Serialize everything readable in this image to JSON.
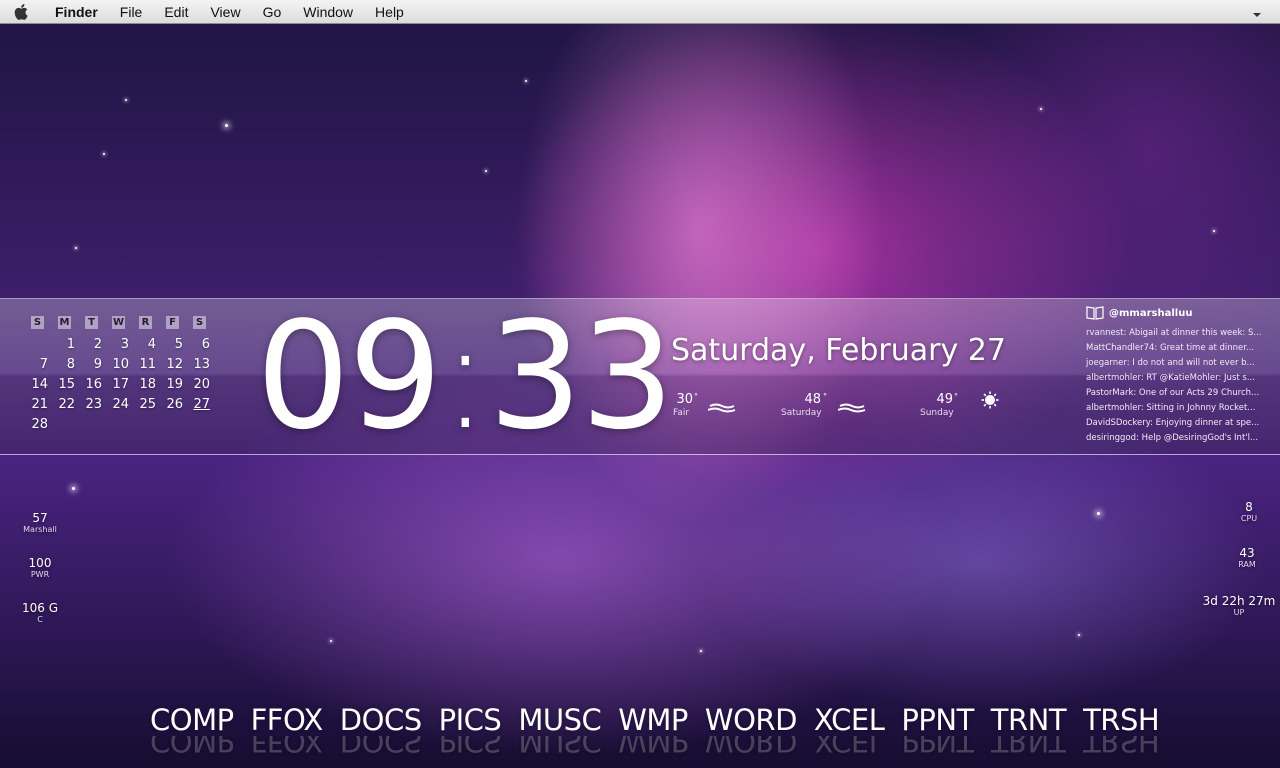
{
  "menubar": {
    "app": "Finder",
    "items": [
      "File",
      "Edit",
      "View",
      "Go",
      "Window",
      "Help"
    ]
  },
  "calendar": {
    "weekdays": [
      "S",
      "M",
      "T",
      "W",
      "R",
      "F",
      "S"
    ],
    "rows": [
      [
        "",
        "1",
        "2",
        "3",
        "4",
        "5",
        "6"
      ],
      [
        "7",
        "8",
        "9",
        "10",
        "11",
        "12",
        "13"
      ],
      [
        "14",
        "15",
        "16",
        "17",
        "18",
        "19",
        "20"
      ],
      [
        "21",
        "22",
        "23",
        "24",
        "25",
        "26",
        "27"
      ],
      [
        "28",
        "",
        "",
        "",
        "",
        "",
        ""
      ]
    ],
    "today": "27"
  },
  "clock": {
    "hours": "09",
    "minutes": "33"
  },
  "date": "Saturday, February 27",
  "weather": [
    {
      "temp": "30",
      "label": "Fair",
      "icon": "cloud-icon"
    },
    {
      "temp": "48",
      "label": "Saturday",
      "icon": "cloud-icon"
    },
    {
      "temp": "49",
      "label": "Sunday",
      "icon": "sun-icon"
    }
  ],
  "twitter": {
    "handle": "@mmarshalluu",
    "tweets": [
      "rvannest: Abigail at dinner this week: S...",
      "MattChandler74: Great time at dinner...",
      "joegarner: I do not and will not ever b...",
      "albertmohler: RT @KatieMohler: Just s...",
      "PastorMark: One of our Acts 29 Church...",
      "albertmohler: Sitting in Johnny Rocket...",
      "DavidSDockery: Enjoying dinner at spe...",
      "desiringgod: Help @DesiringGod's Int'l..."
    ]
  },
  "left_stats": [
    {
      "value": "57",
      "label": "Marshall"
    },
    {
      "value": "100",
      "label": "PWR"
    },
    {
      "value": "106 G",
      "label": "C"
    }
  ],
  "right_stats": [
    {
      "value": "8",
      "label": "CPU"
    },
    {
      "value": "43",
      "label": "RAM"
    },
    {
      "value": "3d 22h 27m",
      "label": "UP"
    }
  ],
  "dock": [
    "COMP",
    "FFOX",
    "DOCS",
    "PICS",
    "MUSC",
    "WMP",
    "WORD",
    "XCEL",
    "PPNT",
    "TRNT",
    "TRSH"
  ]
}
